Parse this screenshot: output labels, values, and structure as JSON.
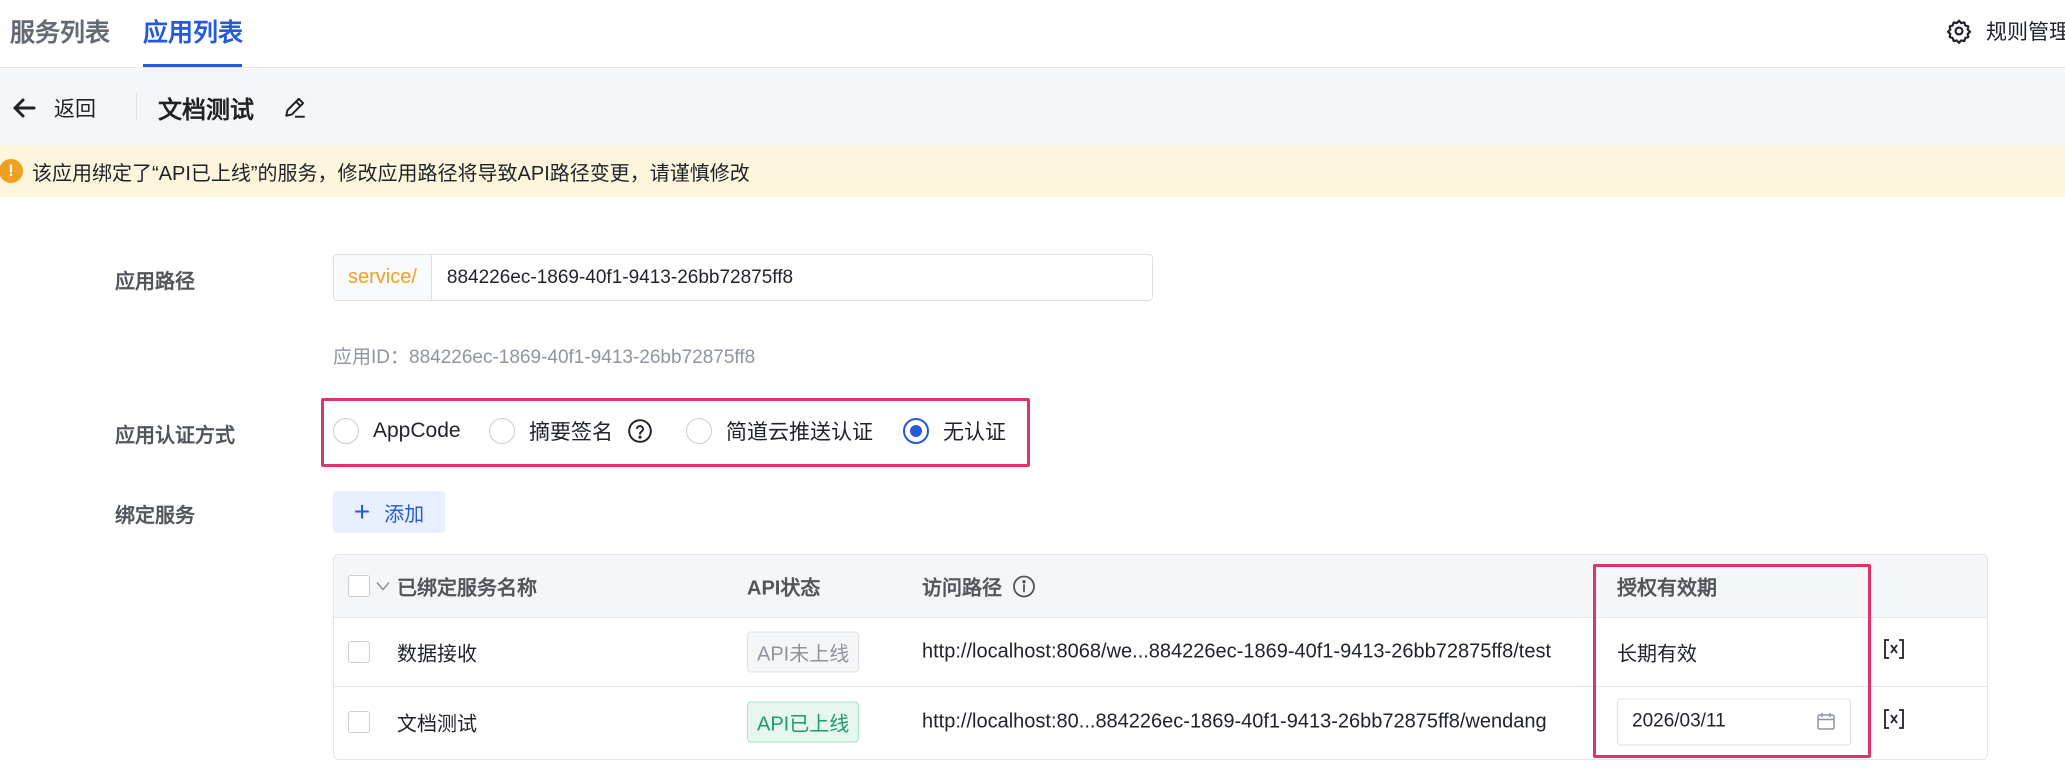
{
  "tabs": [
    {
      "label": "服务列表",
      "active": false
    },
    {
      "label": "应用列表",
      "active": true
    }
  ],
  "header_action": {
    "label": "规则管理",
    "icon": "gear-icon"
  },
  "subheader": {
    "back_label": "返回",
    "title": "文档测试"
  },
  "banner": {
    "icon": "!",
    "message": "该应用绑定了“API已上线”的服务，修改应用路径将导致API路径变更，请谨慎修改"
  },
  "form": {
    "path_label": "应用路径",
    "path_prefix": "service/",
    "path_value": "884226ec-1869-40f1-9413-26bb72875ff8",
    "app_id_text": "应用ID：884226ec-1869-40f1-9413-26bb72875ff8",
    "auth_label": "应用认证方式",
    "auth_options": [
      {
        "label": "AppCode",
        "checked": false
      },
      {
        "label": "摘要签名",
        "checked": false
      },
      {
        "label": "简道云推送认证",
        "checked": false
      },
      {
        "label": "无认证",
        "checked": true
      }
    ],
    "bind_label": "绑定服务",
    "add_label": "添加"
  },
  "table": {
    "headers": {
      "name": "已绑定服务名称",
      "status": "API状态",
      "path": "访问路径",
      "validity": "授权有效期"
    },
    "rows": [
      {
        "name": "数据接收",
        "status": "API未上线",
        "status_type": "off",
        "path": "http://localhost:8068/we...884226ec-1869-40f1-9413-26bb72875ff8/test",
        "validity": "长期有效"
      },
      {
        "name": "文档测试",
        "status": "API已上线",
        "status_type": "on",
        "path": "http://localhost:80...884226ec-1869-40f1-9413-26bb72875ff8/wendang",
        "validity": "2026/03/11"
      }
    ]
  },
  "colors": {
    "accent": "#245bdb",
    "warning_bg": "#fdf6dc",
    "warning_icon": "#f0a020",
    "highlight": "#e0336a",
    "online": "#1e9a6f"
  }
}
